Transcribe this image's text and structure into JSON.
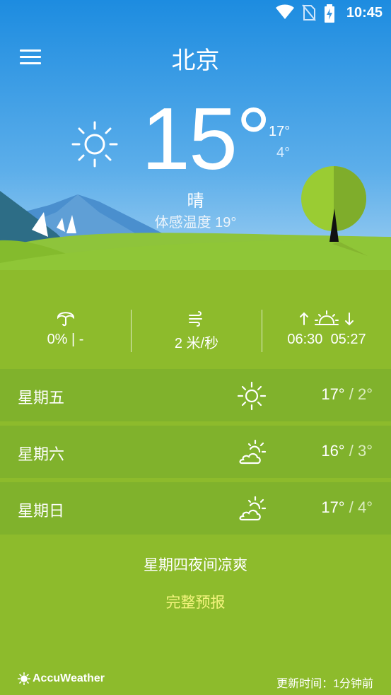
{
  "status_bar": {
    "time": "10:45",
    "icons": [
      "wifi-icon",
      "no-sim-icon",
      "battery-charging-icon"
    ]
  },
  "header": {
    "city": "北京",
    "menu_icon": "hamburger-menu-icon"
  },
  "current": {
    "icon": "sun-icon",
    "temperature": "15°",
    "high": "17°",
    "low": "4°",
    "condition": "晴",
    "feels_like": "体感温度 19°"
  },
  "metrics": {
    "precipitation": {
      "icon": "umbrella-icon",
      "text": "0% | -"
    },
    "wind": {
      "icon": "wind-icon",
      "text": "2 米/秒"
    },
    "sun": {
      "icon": "sunrise-sunset-icon",
      "sunrise": "06:30",
      "sunset": "05:27"
    }
  },
  "forecast": [
    {
      "day": "星期五",
      "icon": "sun-icon",
      "high": "17°",
      "low": "/ 2°"
    },
    {
      "day": "星期六",
      "icon": "partly-cloudy-icon",
      "high": "16°",
      "low": "/ 3°"
    },
    {
      "day": "星期日",
      "icon": "partly-cloudy-icon",
      "high": "17°",
      "low": "/ 4°"
    }
  ],
  "summary": "星期四夜间凉爽",
  "full_forecast_link": "完整预报",
  "footer": {
    "brand": "AccuWeather",
    "updated": "更新时间：1分钟前"
  },
  "colors": {
    "sky_top": "#1f8fe0",
    "sky_bottom": "#8cc4f0",
    "grass": "#8dbb2c",
    "forecast_row": "#80b22c",
    "link_yellow": "#f3f47d"
  }
}
